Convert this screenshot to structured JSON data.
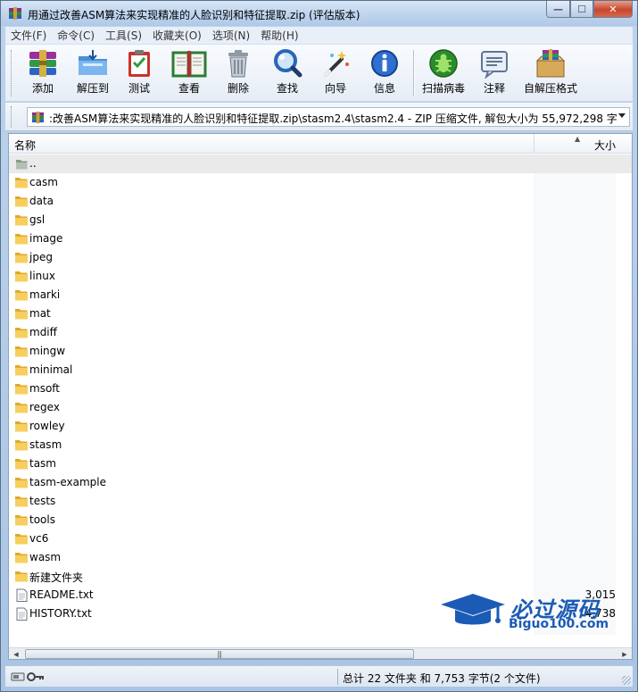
{
  "window": {
    "title": "用通过改善ASM算法来实现精准的人脸识别和特征提取.zip (评估版本)",
    "controls": {
      "minimize": "—",
      "maximize": "☐",
      "close": "✕"
    }
  },
  "menu": [
    "文件(F)",
    "命令(C)",
    "工具(S)",
    "收藏夹(O)",
    "选项(N)",
    "帮助(H)"
  ],
  "toolbar": {
    "add": "添加",
    "extract": "解压到",
    "test": "测试",
    "view": "查看",
    "delete": "删除",
    "find": "查找",
    "wizard": "向导",
    "info": "信息",
    "virus_scan": "扫描病毒",
    "comment": "注释",
    "sfx": "自解压格式"
  },
  "address": {
    "path": ":改善ASM算法来实现精准的人脸识别和特征提取.zip\\stasm2.4\\stasm2.4 - ZIP 压缩文件, 解包大小为 55,972,298 字节"
  },
  "columns": {
    "name": "名称",
    "size": "大小"
  },
  "files": [
    {
      "name": "..",
      "type": "up",
      "size": ""
    },
    {
      "name": "casm",
      "type": "folder",
      "size": ""
    },
    {
      "name": "data",
      "type": "folder",
      "size": ""
    },
    {
      "name": "gsl",
      "type": "folder",
      "size": ""
    },
    {
      "name": "image",
      "type": "folder",
      "size": ""
    },
    {
      "name": "jpeg",
      "type": "folder",
      "size": ""
    },
    {
      "name": "linux",
      "type": "folder",
      "size": ""
    },
    {
      "name": "marki",
      "type": "folder",
      "size": ""
    },
    {
      "name": "mat",
      "type": "folder",
      "size": ""
    },
    {
      "name": "mdiff",
      "type": "folder",
      "size": ""
    },
    {
      "name": "mingw",
      "type": "folder",
      "size": ""
    },
    {
      "name": "minimal",
      "type": "folder",
      "size": ""
    },
    {
      "name": "msoft",
      "type": "folder",
      "size": ""
    },
    {
      "name": "regex",
      "type": "folder",
      "size": ""
    },
    {
      "name": "rowley",
      "type": "folder",
      "size": ""
    },
    {
      "name": "stasm",
      "type": "folder",
      "size": ""
    },
    {
      "name": "tasm",
      "type": "folder",
      "size": ""
    },
    {
      "name": "tasm-example",
      "type": "folder",
      "size": ""
    },
    {
      "name": "tests",
      "type": "folder",
      "size": ""
    },
    {
      "name": "tools",
      "type": "folder",
      "size": ""
    },
    {
      "name": "vc6",
      "type": "folder",
      "size": ""
    },
    {
      "name": "wasm",
      "type": "folder",
      "size": ""
    },
    {
      "name": "新建文件夹",
      "type": "folder",
      "size": ""
    },
    {
      "name": "README.txt",
      "type": "file",
      "size": "3,015"
    },
    {
      "name": "HISTORY.txt",
      "type": "file",
      "size": "4,738"
    }
  ],
  "watermark": {
    "title": "必过源码",
    "subtitle": "Biguo100.com"
  },
  "status": {
    "summary": "总计 22 文件夹 和 7,753 字节(2 个文件)"
  },
  "colors": {
    "folder": "#f2c14e",
    "accent": "#1c5bb5",
    "selection": "#eaeaea"
  }
}
